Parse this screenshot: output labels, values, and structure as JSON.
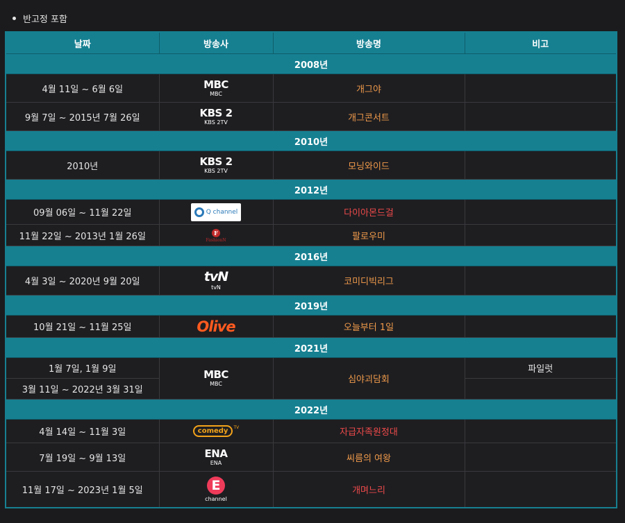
{
  "bullet": "반고정 포함",
  "headers": {
    "date": "날짜",
    "broadcaster": "방송사",
    "program": "방송명",
    "note": "비고"
  },
  "years": {
    "y2008": "2008년",
    "y2010": "2010년",
    "y2012": "2012년",
    "y2016": "2016년",
    "y2019": "2019년",
    "y2021": "2021년",
    "y2022": "2022년"
  },
  "logos": {
    "mbc": {
      "main": "MBC",
      "sub": "MBC"
    },
    "kbs2": {
      "main": "KBS 2",
      "sub": "KBS 2TV"
    },
    "qchannel": "Q channel",
    "fashionn": {
      "mark": "F",
      "text": "FashionN"
    },
    "tvn": {
      "main": "tvN",
      "sub": "tvN"
    },
    "olive": "Olive",
    "comedytv": {
      "main": "comedy",
      "tv": "TV"
    },
    "ena": {
      "main": "ENA",
      "sub": "ENA"
    },
    "echannel": {
      "main": "E",
      "sub": "channel"
    }
  },
  "rows": {
    "r1": {
      "date": "4월 11일 ~ 6월 6일",
      "program": "개그야"
    },
    "r2": {
      "date": "9월 7일 ~ 2015년 7월 26일",
      "program": "개그콘서트"
    },
    "r3": {
      "date": "2010년",
      "program": "모닝와이드"
    },
    "r4": {
      "date": "09월 06일 ~ 11월 22일",
      "program": "다이아몬드걸"
    },
    "r5": {
      "date": "11월 22일 ~ 2013년 1월 26일",
      "program": "팔로우미"
    },
    "r6": {
      "date": "4월 3일 ~ 2020년 9월 20일",
      "program": "코미디빅리그"
    },
    "r7": {
      "date": "10월 21일 ~ 11월 25일",
      "program": "오늘부터 1일"
    },
    "r8a": {
      "date": "1월 7일, 1월 9일",
      "note": "파일럿"
    },
    "r8b": {
      "date": "3월 11일 ~ 2022년 3월 31일"
    },
    "r8": {
      "program": "심야괴담회"
    },
    "r9": {
      "date": "4월 14일 ~ 11월 3일",
      "program": "자급자족원정대"
    },
    "r10": {
      "date": "7월 19일 ~ 9월 13일",
      "program": "씨름의 여왕"
    },
    "r11": {
      "date": "11월 17일 ~ 2023년 1월 5일",
      "program": "개며느리"
    }
  }
}
